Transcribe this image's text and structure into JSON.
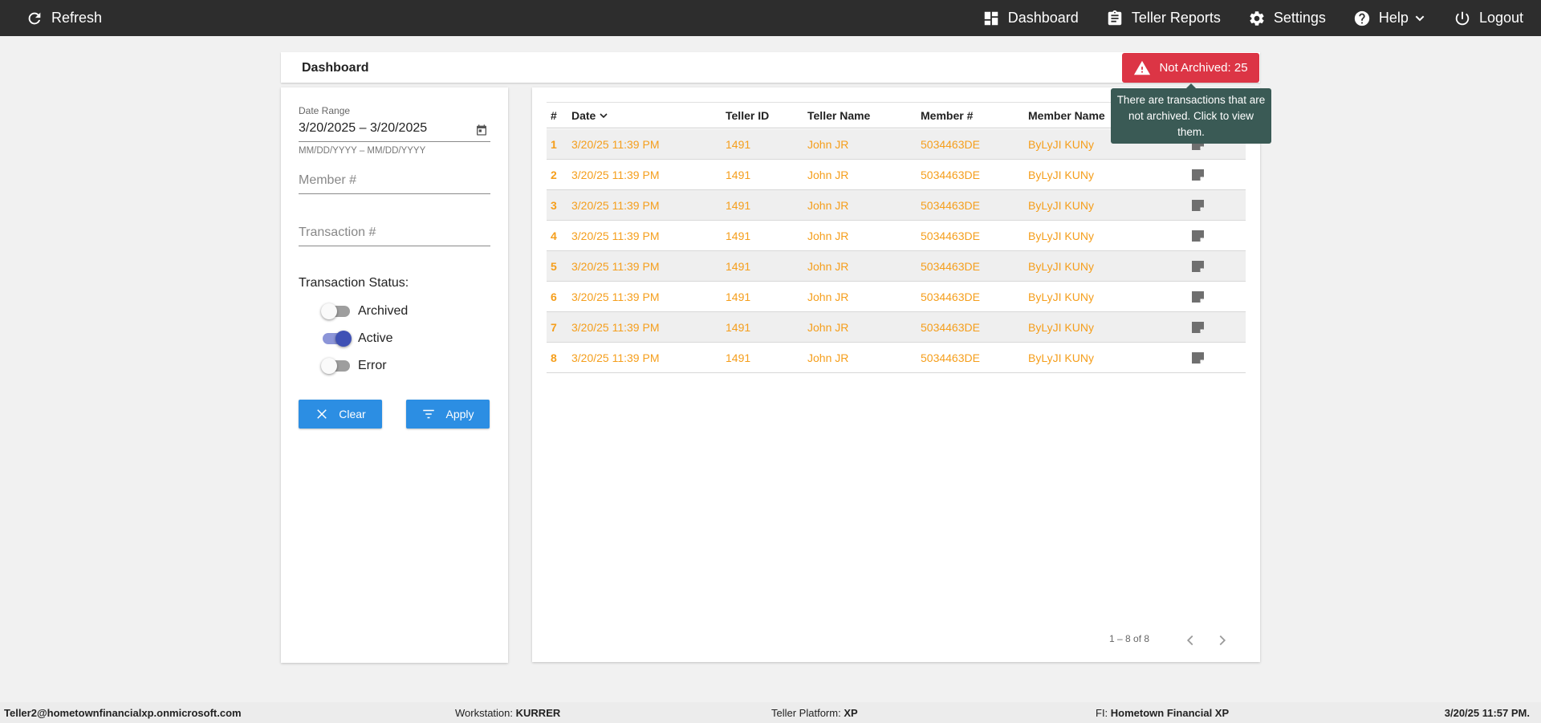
{
  "topbar": {
    "refresh_label": "Refresh",
    "nav": [
      {
        "label": "Dashboard",
        "icon": "dashboard-icon"
      },
      {
        "label": "Teller Reports",
        "icon": "clipboard-icon"
      },
      {
        "label": "Settings",
        "icon": "gear-icon"
      },
      {
        "label": "Help",
        "icon": "help-icon"
      },
      {
        "label": "Logout",
        "icon": "power-icon"
      }
    ]
  },
  "header": {
    "title": "Dashboard",
    "alert_label": "Not Archived: 25",
    "alert_color": "#dc3545",
    "tooltip": "There are transactions that are not archived. Click to view them."
  },
  "filters": {
    "date_range_label": "Date Range",
    "date_range_value": "3/20/2025 – 3/20/2025",
    "date_hint": "MM/DD/YYYY – MM/DD/YYYY",
    "member_placeholder": "Member #",
    "transaction_placeholder": "Transaction #",
    "status_label": "Transaction Status:",
    "toggles": [
      {
        "label": "Archived",
        "on": false
      },
      {
        "label": "Active",
        "on": true
      },
      {
        "label": "Error",
        "on": false
      }
    ],
    "clear_label": "Clear",
    "apply_label": "Apply"
  },
  "table": {
    "columns": [
      "#",
      "Date",
      "Teller ID",
      "Teller Name",
      "Member #",
      "Member Name"
    ],
    "rows": [
      {
        "idx": "1",
        "date": "3/20/25 11:39 PM",
        "teller_id": "1491",
        "teller_name": "John JR",
        "member": "5034463DE",
        "member_name": "ByLyJI KUNy"
      },
      {
        "idx": "2",
        "date": "3/20/25 11:39 PM",
        "teller_id": "1491",
        "teller_name": "John JR",
        "member": "5034463DE",
        "member_name": "ByLyJI KUNy"
      },
      {
        "idx": "3",
        "date": "3/20/25 11:39 PM",
        "teller_id": "1491",
        "teller_name": "John JR",
        "member": "5034463DE",
        "member_name": "ByLyJI KUNy"
      },
      {
        "idx": "4",
        "date": "3/20/25 11:39 PM",
        "teller_id": "1491",
        "teller_name": "John JR",
        "member": "5034463DE",
        "member_name": "ByLyJI KUNy"
      },
      {
        "idx": "5",
        "date": "3/20/25 11:39 PM",
        "teller_id": "1491",
        "teller_name": "John JR",
        "member": "5034463DE",
        "member_name": "ByLyJI KUNy"
      },
      {
        "idx": "6",
        "date": "3/20/25 11:39 PM",
        "teller_id": "1491",
        "teller_name": "John JR",
        "member": "5034463DE",
        "member_name": "ByLyJI KUNy"
      },
      {
        "idx": "7",
        "date": "3/20/25 11:39 PM",
        "teller_id": "1491",
        "teller_name": "John JR",
        "member": "5034463DE",
        "member_name": "ByLyJI KUNy"
      },
      {
        "idx": "8",
        "date": "3/20/25 11:39 PM",
        "teller_id": "1491",
        "teller_name": "John JR",
        "member": "5034463DE",
        "member_name": "ByLyJI KUNy"
      }
    ],
    "row_text_color": "#f59e1b",
    "pager_text": "1 – 8 of 8"
  },
  "footer": {
    "user": "Teller2@hometownfinancialxp.onmicrosoft.com",
    "workstation_label": "Workstation:",
    "workstation_value": "KURRER",
    "platform_label": "Teller Platform:",
    "platform_value": "XP",
    "fi_label": "FI:",
    "fi_value": "Hometown Financial XP",
    "datetime": "3/20/25 11:57 PM."
  }
}
